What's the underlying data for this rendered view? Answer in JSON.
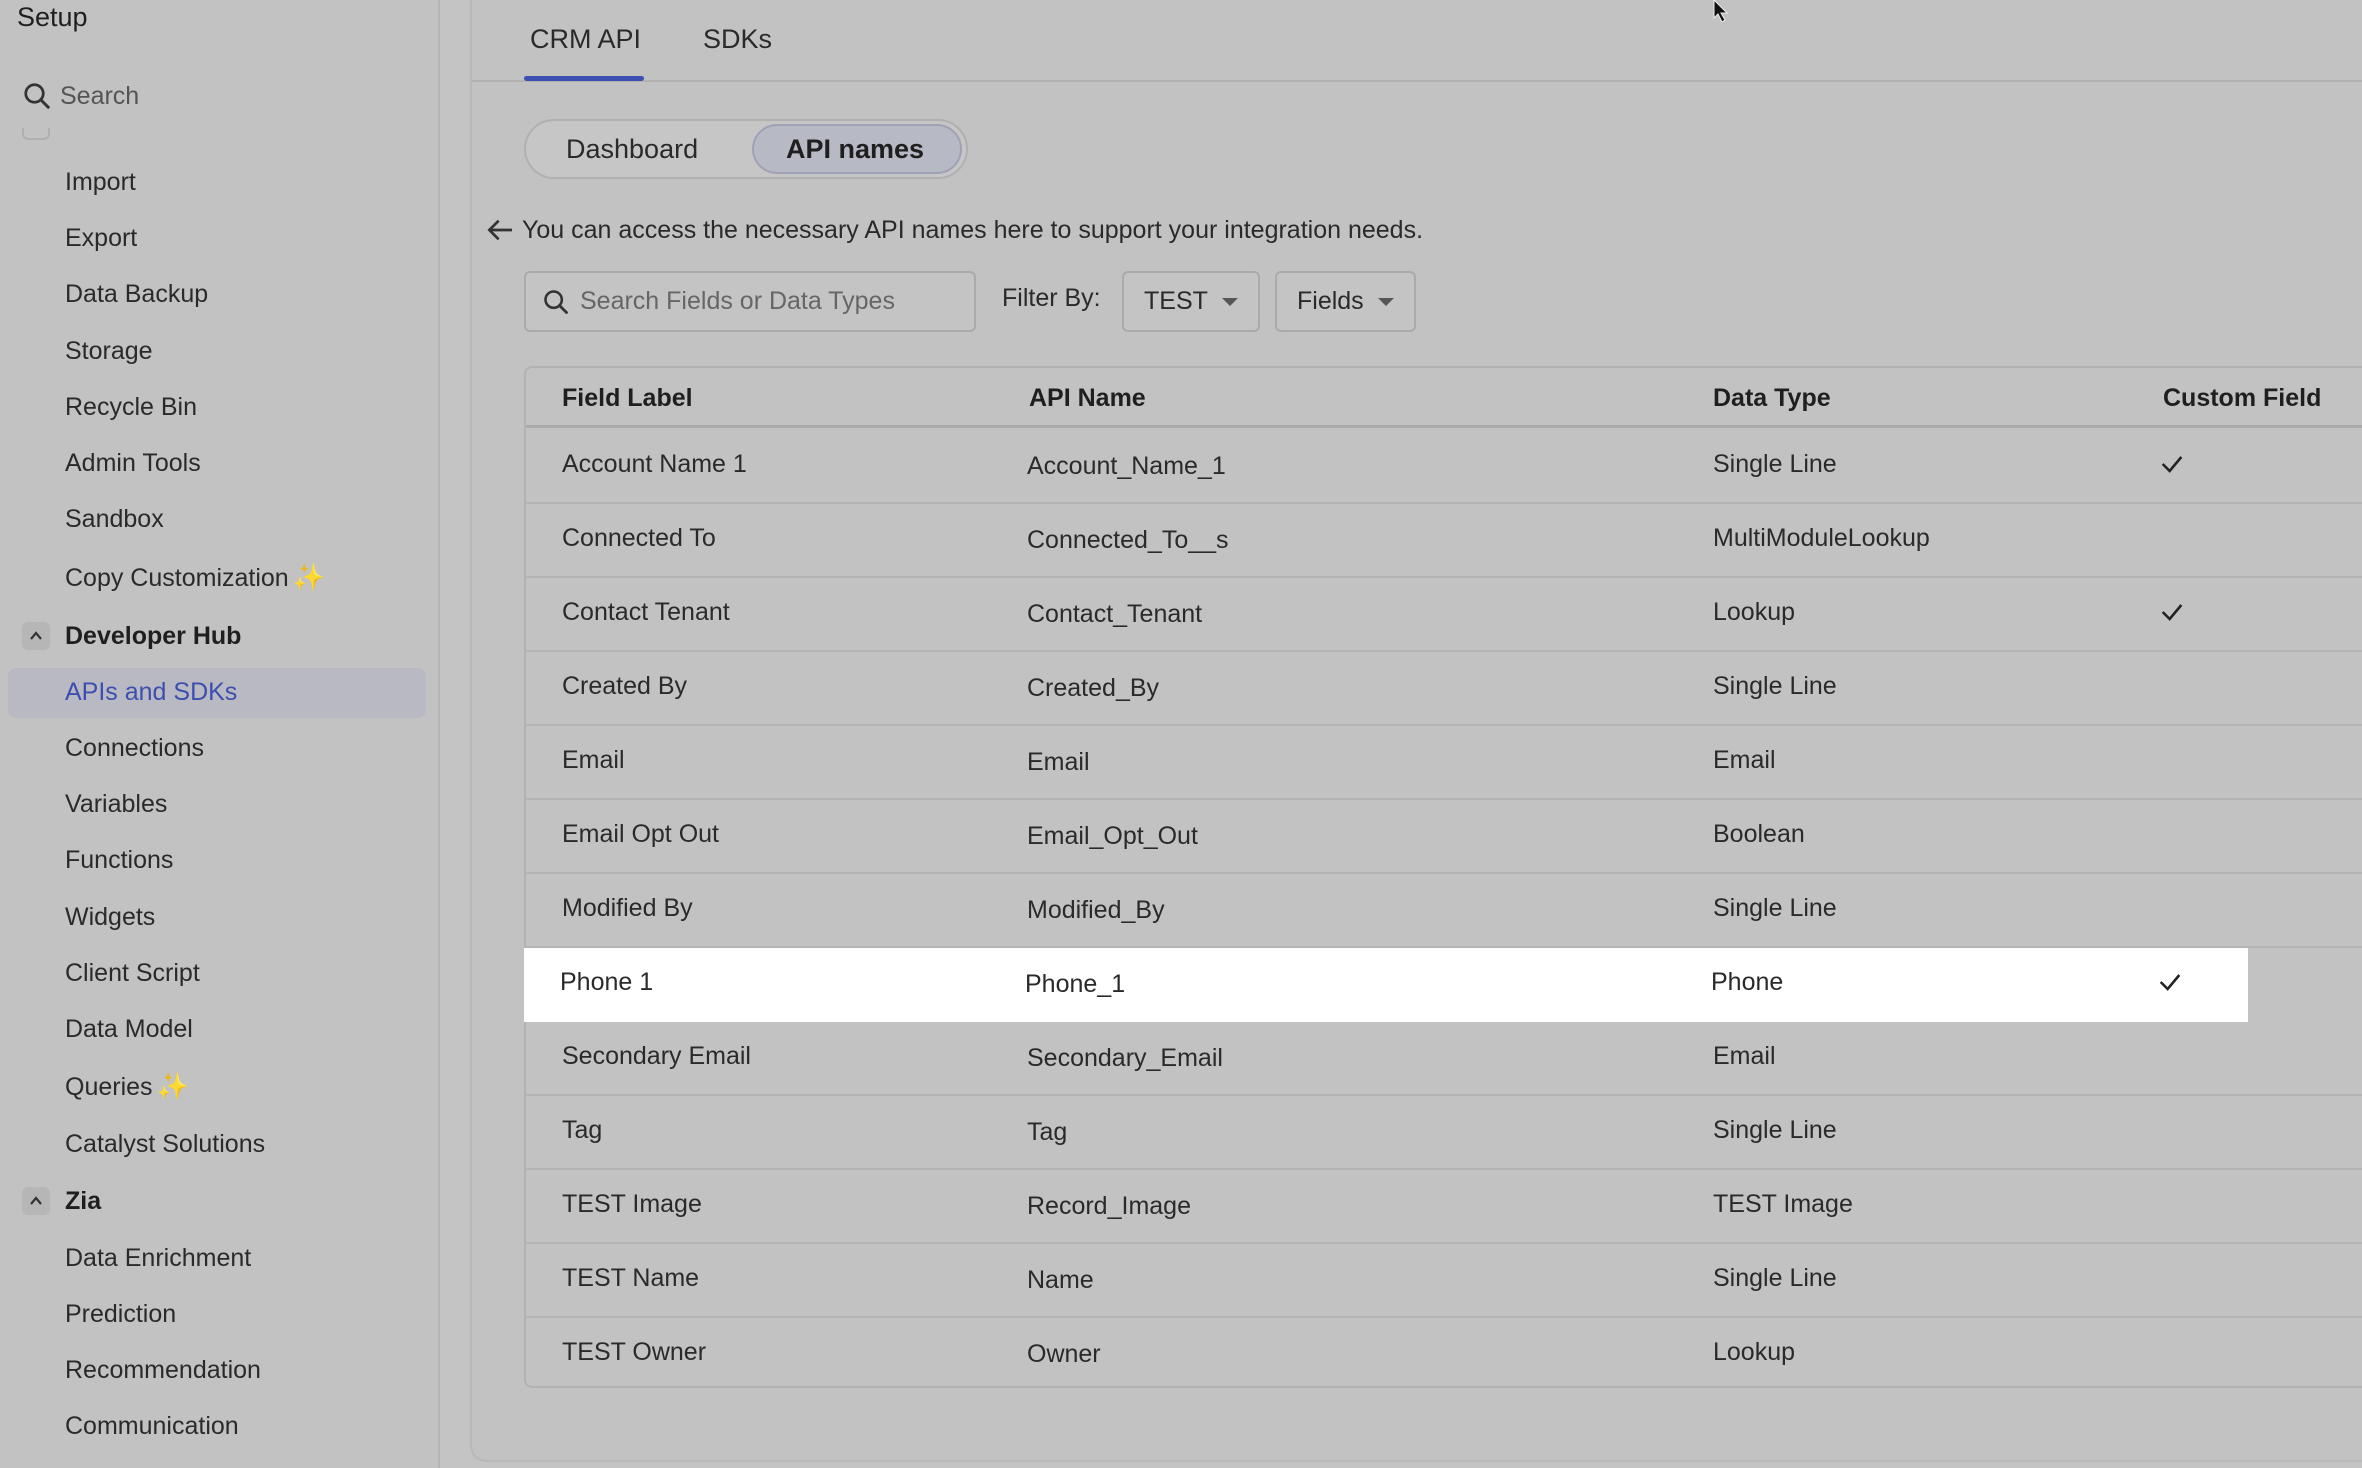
{
  "sidebar": {
    "title": "Setup",
    "search_label": "Search",
    "items": [
      {
        "label": "Import"
      },
      {
        "label": "Export"
      },
      {
        "label": "Data Backup"
      },
      {
        "label": "Storage"
      },
      {
        "label": "Recycle Bin"
      },
      {
        "label": "Admin Tools"
      },
      {
        "label": "Sandbox"
      },
      {
        "label": "Copy Customization",
        "badge": "✨"
      }
    ],
    "groups": [
      {
        "label": "Developer Hub",
        "items": [
          {
            "label": "APIs and SDKs",
            "active": true
          },
          {
            "label": "Connections"
          },
          {
            "label": "Variables"
          },
          {
            "label": "Functions"
          },
          {
            "label": "Widgets"
          },
          {
            "label": "Client Script"
          },
          {
            "label": "Data Model"
          },
          {
            "label": "Queries",
            "badge": "✨"
          },
          {
            "label": "Catalyst Solutions"
          }
        ]
      },
      {
        "label": "Zia",
        "items": [
          {
            "label": "Data Enrichment"
          },
          {
            "label": "Prediction"
          },
          {
            "label": "Recommendation"
          },
          {
            "label": "Communication"
          }
        ]
      }
    ]
  },
  "main": {
    "tabs": [
      {
        "label": "CRM API",
        "active": true
      },
      {
        "label": "SDKs"
      }
    ],
    "segments": [
      {
        "label": "Dashboard"
      },
      {
        "label": "API names",
        "active": true
      }
    ],
    "info_text": "You can access the necessary API names here to support your integration needs.",
    "search_placeholder": "Search Fields or Data Types",
    "filter_label": "Filter By:",
    "filter_module": "TEST",
    "filter_type": "Fields",
    "table": {
      "headers": [
        "Field Label",
        "API Name",
        "Data Type",
        "Custom Field"
      ],
      "rows": [
        {
          "label": "Account Name 1",
          "api": "Account_Name_1",
          "type": "Single Line",
          "custom": true
        },
        {
          "label": "Connected To",
          "api": "Connected_To__s",
          "type": "MultiModuleLookup",
          "custom": false
        },
        {
          "label": "Contact Tenant",
          "api": "Contact_Tenant",
          "type": "Lookup",
          "custom": true
        },
        {
          "label": "Created By",
          "api": "Created_By",
          "type": "Single Line",
          "custom": false
        },
        {
          "label": "Email",
          "api": "Email",
          "type": "Email",
          "custom": false
        },
        {
          "label": "Email Opt Out",
          "api": "Email_Opt_Out",
          "type": "Boolean",
          "custom": false
        },
        {
          "label": "Modified By",
          "api": "Modified_By",
          "type": "Single Line",
          "custom": false
        },
        {
          "label": "Phone 1",
          "api": "Phone_1",
          "type": "Phone",
          "custom": true,
          "highlighted": true
        },
        {
          "label": "Secondary Email",
          "api": "Secondary_Email",
          "type": "Email",
          "custom": false
        },
        {
          "label": "Tag",
          "api": "Tag",
          "type": "Single Line",
          "custom": false
        },
        {
          "label": "TEST Image",
          "api": "Record_Image",
          "type": "TEST Image",
          "custom": false
        },
        {
          "label": "TEST Name",
          "api": "Name",
          "type": "Single Line",
          "custom": false
        },
        {
          "label": "TEST Owner",
          "api": "Owner",
          "type": "Lookup",
          "custom": false
        }
      ]
    }
  },
  "colors": {
    "accent": "#3c4fb0",
    "sparkle": "#d8a41c",
    "highlight_row": "#ffffff"
  }
}
